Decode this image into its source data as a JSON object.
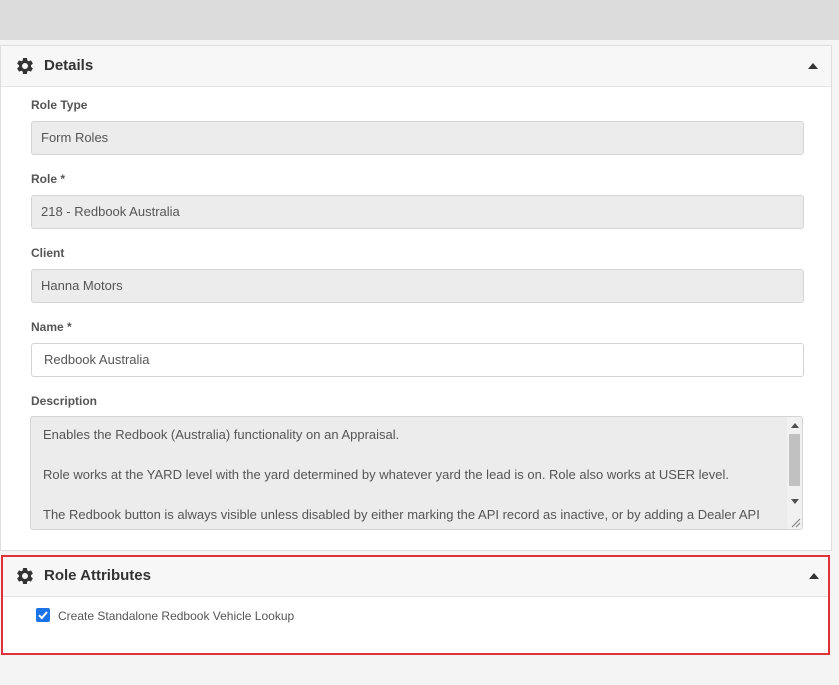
{
  "details": {
    "title": "Details",
    "role_type": {
      "label": "Role Type",
      "value": "Form Roles"
    },
    "role": {
      "label": "Role *",
      "value": "218 - Redbook Australia"
    },
    "client": {
      "label": "Client",
      "value": "Hanna Motors"
    },
    "name": {
      "label": "Name *",
      "value": "Redbook Australia"
    },
    "description": {
      "label": "Description",
      "paragraphs": [
        "Enables the Redbook (Australia) functionality on an Appraisal.",
        "Role works at the YARD level with the yard determined by whatever yard the lead is on.  Role also works at USER level.",
        "The Redbook button is always visible unless disabled by either marking the API record as inactive, or by adding a Dealer API record for Redbook and marking that record as inactive."
      ]
    }
  },
  "role_attributes": {
    "title": "Role Attributes",
    "checkbox_label": "Create Standalone Redbook Vehicle Lookup",
    "checked": true
  },
  "colors": {
    "accent": "#1a73e8",
    "highlight_border": "#e0313a"
  }
}
